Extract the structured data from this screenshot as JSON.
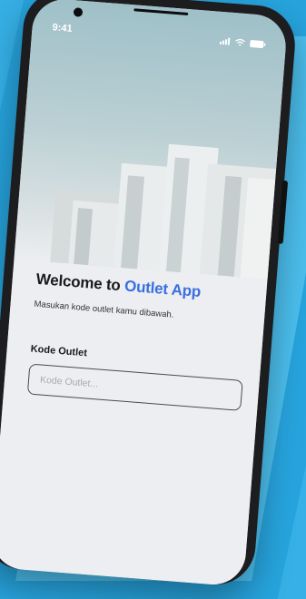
{
  "status_bar": {
    "time": "9:41"
  },
  "welcome": {
    "prefix": "Welcome to ",
    "brand": "Outlet App"
  },
  "subtitle": "Masukan kode outlet kamu dibawah.",
  "form": {
    "label": "Kode Outlet",
    "placeholder": "Kode Outlet...",
    "value": ""
  },
  "colors": {
    "background": "#36b0e6",
    "brand": "#3b6fe0",
    "phone_frame": "#1d1d1f"
  },
  "icons": [
    "signal-icon",
    "wifi-icon",
    "battery-icon"
  ]
}
